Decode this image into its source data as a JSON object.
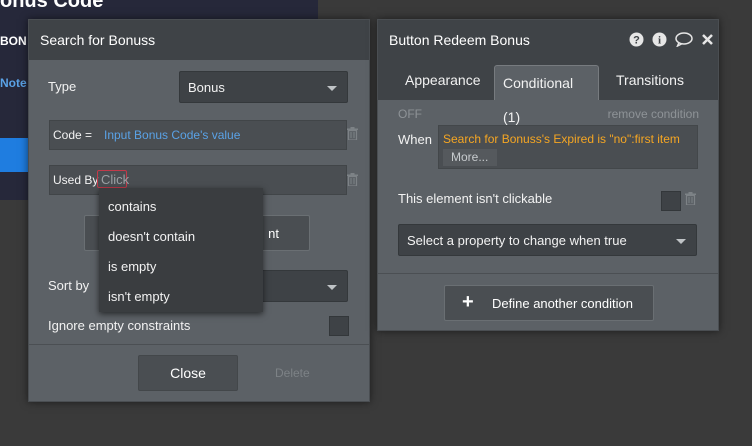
{
  "background": {
    "title_fragment": "onus Code",
    "label_fragment": "BON",
    "note_fragment": "Note"
  },
  "search_panel": {
    "title": "Search for Bonuss",
    "type_label": "Type",
    "type_value": "Bonus",
    "constraint1_key": "Code =",
    "constraint1_value": "Input Bonus Code's value",
    "constraint2_key": "Used By",
    "constraint2_placeholder": "Click",
    "hidden_button_label_fragment": "nt",
    "sort_by_label": "Sort by",
    "ignore_empty_label": "Ignore empty constraints",
    "close_label": "Close",
    "delete_label": "Delete"
  },
  "operator_menu": {
    "items": [
      "contains",
      "doesn't contain",
      "is empty",
      "isn't empty"
    ]
  },
  "cond_panel": {
    "title": "Button Redeem Bonus",
    "tabs": [
      {
        "label": "Appearance"
      },
      {
        "label": "Conditional (1)"
      },
      {
        "label": "Transitions"
      }
    ],
    "off_label": "OFF",
    "remove_label": "remove condition",
    "when_label": "When",
    "when_expression": "Search for Bonuss's Expired is \"no\":first item",
    "more_label": "More...",
    "not_clickable_label": "This element isn't clickable",
    "property_placeholder": "Select a property to change when true",
    "define_label": "Define another condition"
  },
  "colors": {
    "panel": "#5c6166",
    "header": "#3f4347",
    "dynamic_blue": "#5aa2e6",
    "orange": "#f5a623"
  }
}
